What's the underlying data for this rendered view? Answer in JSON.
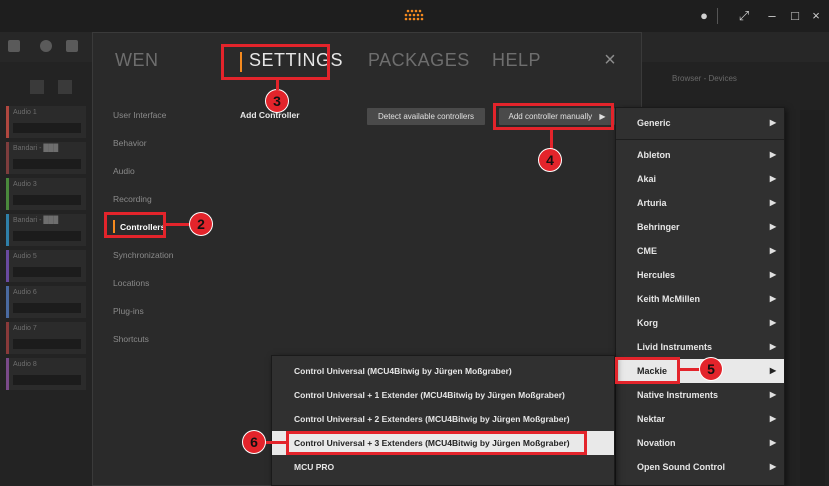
{
  "dialog": {
    "tabs": [
      {
        "label": "WEN",
        "active": false
      },
      {
        "label": "SETTINGS",
        "active": true
      },
      {
        "label": "PACKAGES",
        "active": false
      },
      {
        "label": "HELP",
        "active": false
      }
    ],
    "close_label": "×",
    "nav": [
      "User Interface",
      "Behavior",
      "Audio",
      "Recording",
      "Controllers",
      "Synchronization",
      "Locations",
      "Plug-ins",
      "Shortcuts"
    ],
    "add_controller_label": "Add Controller",
    "detect_button": "Detect available controllers",
    "add_manually_button": "Add controller manually",
    "add_manually_arrow": "▶"
  },
  "vendor_menu": {
    "items": [
      "Generic",
      "Ableton",
      "Akai",
      "Arturia",
      "Behringer",
      "CME",
      "Hercules",
      "Keith McMillen",
      "Korg",
      "Livid Instruments",
      "Mackie",
      "Native Instruments",
      "Nektar",
      "Novation",
      "Open Sound Control"
    ],
    "selected": "Mackie",
    "arrow": "▶"
  },
  "sub_menu": {
    "items": [
      "Control Universal (MCU4Bitwig by Jürgen Moßgraber)",
      "Control Universal + 1 Extender (MCU4Bitwig by Jürgen Moßgraber)",
      "Control Universal + 2 Extenders (MCU4Bitwig by Jürgen Moßgraber)",
      "Control Universal + 3 Extenders (MCU4Bitwig by Jürgen Moßgraber)",
      "MCU PRO"
    ],
    "selected": "Control Universal + 3 Extenders (MCU4Bitwig by Jürgen Moßgraber)"
  },
  "background": {
    "tracks": [
      "Audio 1",
      "Bandari - ███",
      "Audio 3",
      "Bandari - ███",
      "Audio 5",
      "Audio 6",
      "Audio 7",
      "Audio 8"
    ],
    "track_colors": [
      "#b0473f",
      "#7e3d3d",
      "#4a8a3c",
      "#2f7fa8",
      "#6a4aa0",
      "#4a6aa0",
      "#8a3a3a",
      "#7a4a8a"
    ],
    "browser_title": "Browser - Devices"
  },
  "window_controls": {
    "minimize": "–",
    "maximize": "□",
    "close": "×"
  },
  "annotations": [
    "2",
    "3",
    "4",
    "5",
    "6"
  ],
  "colors": {
    "accent": "#f58a1f",
    "annotation": "#e3242b",
    "dialog_bg": "#2a2a2a",
    "menu_bg": "#303030",
    "selected_bg": "#e9e9e9"
  }
}
